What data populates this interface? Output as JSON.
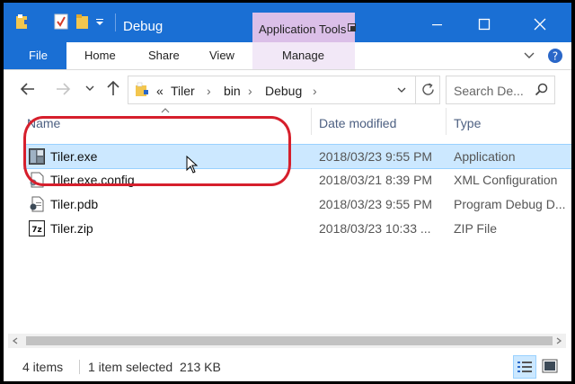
{
  "window": {
    "title": "Debug",
    "context_tab": "Application Tools",
    "minimize_icon": "minimize-icon",
    "maximize_icon": "maximize-icon",
    "close_icon": "close-icon"
  },
  "ribbon": {
    "file": "File",
    "tabs": [
      "Home",
      "Share",
      "View"
    ],
    "manage": "Manage"
  },
  "address": {
    "overflow": "«",
    "crumbs": [
      "Tiler",
      "bin",
      "Debug"
    ]
  },
  "search": {
    "placeholder": "Search De..."
  },
  "columns": {
    "name": "Name",
    "date": "Date modified",
    "type": "Type"
  },
  "files": [
    {
      "name": "Tiler.exe",
      "date": "2018/03/23 9:55 PM",
      "type": "Application",
      "icon": "exe-file-icon"
    },
    {
      "name": "Tiler.exe.config",
      "date": "2018/03/21 8:39 PM",
      "type": "XML Configuration",
      "icon": "config-file-icon"
    },
    {
      "name": "Tiler.pdb",
      "date": "2018/03/23 9:55 PM",
      "type": "Program Debug D...",
      "icon": "pdb-file-icon"
    },
    {
      "name": "Tiler.zip",
      "date": "2018/03/23 10:33 ...",
      "type": "ZIP File",
      "icon": "zip-file-icon"
    }
  ],
  "status": {
    "count": "4 items",
    "selection": "1 item selected  213 KB"
  },
  "colors": {
    "accent": "#1a6fd4",
    "selection": "#cce8ff",
    "annotation": "#d61f2c",
    "context": "#dbbfe8"
  }
}
